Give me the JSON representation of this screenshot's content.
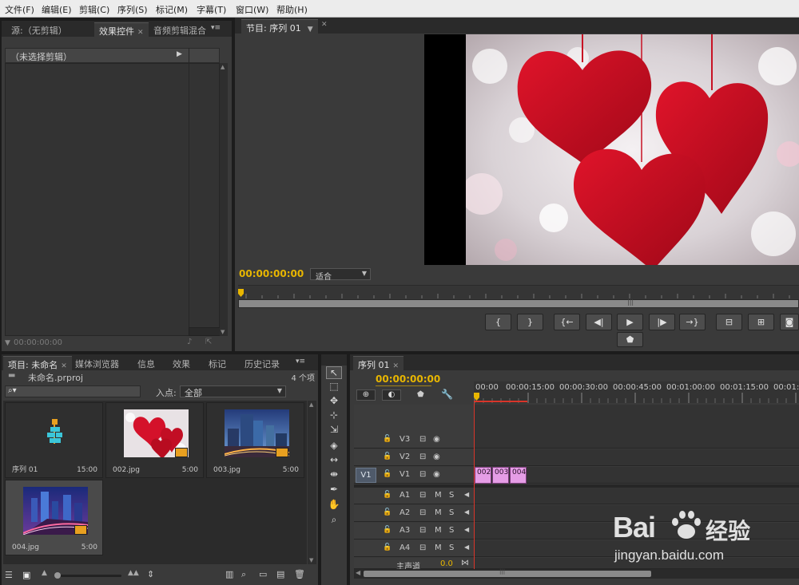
{
  "menubar": {
    "items": [
      "文件(F)",
      "编辑(E)",
      "剪辑(C)",
      "序列(S)",
      "标记(M)",
      "字幕(T)",
      "窗口(W)",
      "帮助(H)"
    ]
  },
  "source_panel": {
    "tabs": [
      "源:（无剪辑）",
      "效果控件",
      "音频剪辑混合"
    ],
    "active_tab": "效果控件",
    "no_clip_label": "（未选择剪辑）",
    "timecode": "00:00:00:00"
  },
  "program_monitor": {
    "tab": "节目: 序列 01",
    "timecode": "00:00:00:00",
    "fit_label": "适合",
    "buttons": [
      "{",
      "}",
      "{←",
      "◀|",
      "▶",
      "|▶",
      "→}"
    ]
  },
  "project_panel": {
    "tabs": [
      "项目: 未命名",
      "媒体浏览器",
      "信息",
      "效果",
      "标记",
      "历史记录"
    ],
    "project_file": "未命名.prproj",
    "item_count": "4 个项",
    "in_point_label": "入点:",
    "in_point_value": "全部",
    "items": [
      {
        "name": "序列 01",
        "duration": "15:00",
        "kind": "sequence"
      },
      {
        "name": "002.jpg",
        "duration": "5:00",
        "kind": "hearts"
      },
      {
        "name": "003.jpg",
        "duration": "5:00",
        "kind": "city"
      },
      {
        "name": "004.jpg",
        "duration": "5:00",
        "kind": "city-night"
      }
    ]
  },
  "timeline": {
    "tab": "序列 01",
    "timecode": "00:00:00:00",
    "ruler": [
      "00:00",
      "00:00:15:00",
      "00:00:30:00",
      "00:00:45:00",
      "00:01:00:00",
      "00:01:15:00",
      "00:01:3"
    ],
    "video_tracks": [
      "V3",
      "V2",
      "V1"
    ],
    "source_patch": "V1",
    "audio_tracks": [
      "A1",
      "A2",
      "A3",
      "A4"
    ],
    "master_label": "主声道",
    "master_value": "0.0",
    "clips": [
      "002",
      "003",
      "004"
    ],
    "clip_color": "#e59de6",
    "mute_label": "M",
    "solo_label": "S"
  },
  "watermark": {
    "brand": "Bai",
    "brand2": "经验",
    "url": "jingyan.baidu.com"
  },
  "colors": {
    "timecode": "#e8b600",
    "playhead": "#d9352a"
  }
}
